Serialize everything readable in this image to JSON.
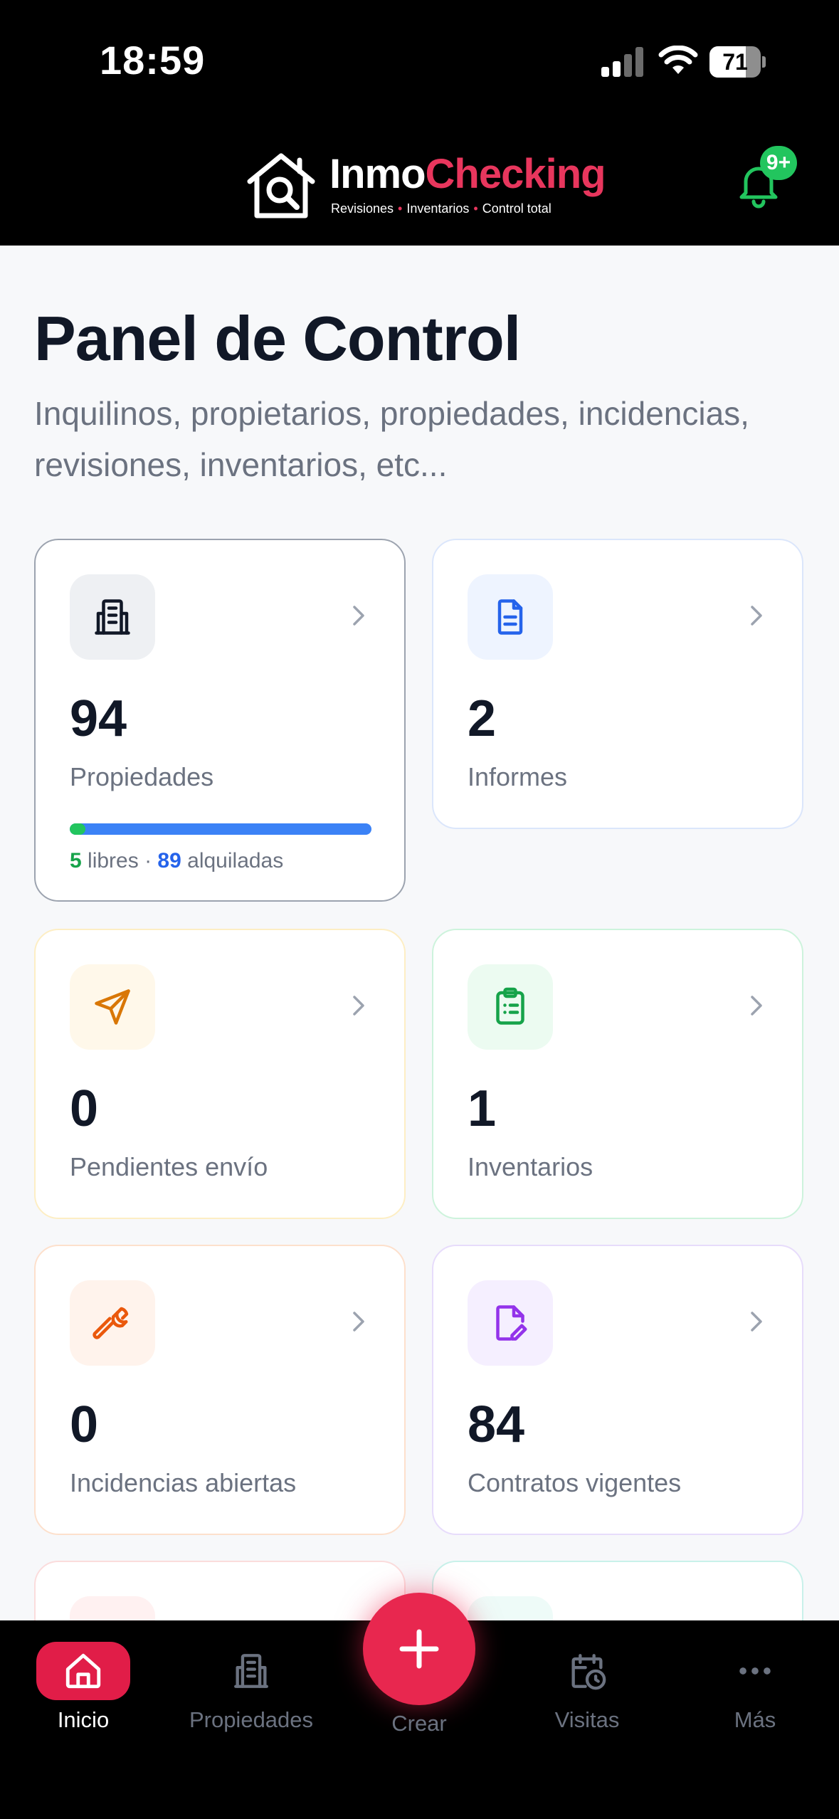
{
  "status_bar": {
    "time": "18:59",
    "battery": "71",
    "battery_level": 0.71
  },
  "header": {
    "logo_inmo": "Inmo",
    "logo_checking": "Checking",
    "tagline_1": "Revisiones",
    "tagline_2": "Inventarios",
    "tagline_3": "Control total",
    "notification_badge": "9+"
  },
  "main": {
    "title": "Panel de Control",
    "subtitle": "Inquilinos, propietarios, propiedades, incidencias, revisiones, inventarios, etc..."
  },
  "cards": [
    {
      "key": "propiedades",
      "value": "94",
      "label": "Propiedades",
      "icon": "building-icon",
      "accent": "#111827",
      "icon_bg": "#eef0f3"
    },
    {
      "key": "informes",
      "value": "2",
      "label": "Informes",
      "icon": "document-icon",
      "accent": "#2563eb",
      "icon_bg": "#eef4ff"
    },
    {
      "key": "pendientes",
      "value": "0",
      "label": "Pendientes envío",
      "icon": "send-icon",
      "accent": "#d97706",
      "icon_bg": "#fff8ea"
    },
    {
      "key": "inventarios",
      "value": "1",
      "label": "Inventarios",
      "icon": "clipboard-icon",
      "accent": "#16a34a",
      "icon_bg": "#ecfbf1"
    },
    {
      "key": "incidencias",
      "value": "0",
      "label": "Incidencias abiertas",
      "icon": "wrench-icon",
      "accent": "#ea580c",
      "icon_bg": "#fff3ec"
    },
    {
      "key": "contratos",
      "value": "84",
      "label": "Contratos vigentes",
      "icon": "edit-document-icon",
      "accent": "#9333ea",
      "icon_bg": "#f5efff"
    }
  ],
  "propiedades_stats": {
    "free_count": "5",
    "free_label": "libres",
    "separator": "·",
    "rented_count": "89",
    "rented_label": "alquiladas",
    "free_fraction": 0.053
  },
  "bottom_nav": {
    "items": [
      {
        "label": "Inicio",
        "icon": "home-icon",
        "active": true
      },
      {
        "label": "Propiedades",
        "icon": "building-icon",
        "active": false
      },
      {
        "label": "Visitas",
        "icon": "calendar-clock-icon",
        "active": false
      },
      {
        "label": "Más",
        "icon": "more-icon",
        "active": false
      }
    ],
    "create_label": "Crear"
  },
  "colors": {
    "brand": "#e8365d",
    "success": "#22c55e",
    "primary": "#3b82f6"
  }
}
